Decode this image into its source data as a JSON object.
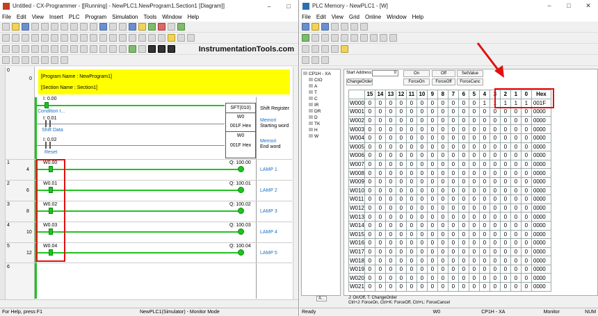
{
  "left_window": {
    "title": "Untitled - CX-Programmer - [[Running] - NewPLC1.NewProgram1.Section1 [Diagram]]",
    "menu": [
      "File",
      "Edit",
      "View",
      "Insert",
      "PLC",
      "Program",
      "Simulation",
      "Tools",
      "Window",
      "Help"
    ],
    "brand": "InstrumentationTools.com",
    "program_name": "[Program Name : NewProgram1]",
    "section_name": "[Section Name : Section1]",
    "rung0": {
      "num": "0",
      "step": "0",
      "c1_addr": "I: 0.00",
      "c1_label": "Condition I...",
      "c2_addr": "I: 0.01",
      "c2_label": "Shift Data",
      "c3_addr": "I: 0.02",
      "c3_label": "Reset",
      "box_title": "SFT(010)",
      "box_op1": "W0",
      "box_op2": "001F Hex",
      "box_op3": "W0",
      "box_op4": "001F Hex",
      "r_label1": "Shift Register",
      "r_mem1": "Memori",
      "r_word1": "Starting word",
      "r_mem2": "Memori",
      "r_word2": "End word"
    },
    "rungs": [
      {
        "num": "1",
        "step": "4",
        "contact": "W0.00",
        "coil": "Q: 100.00",
        "lamp": "LAMP 1"
      },
      {
        "num": "2",
        "step": "6",
        "contact": "W0.01",
        "coil": "Q: 100.01",
        "lamp": "LAMP 2"
      },
      {
        "num": "3",
        "step": "8",
        "contact": "W0.02",
        "coil": "Q: 100.02",
        "lamp": "LAMP 3"
      },
      {
        "num": "4",
        "step": "10",
        "contact": "W0.03",
        "coil": "Q: 100.03",
        "lamp": "LAMP 4"
      },
      {
        "num": "5",
        "step": "12",
        "contact": "W0.04",
        "coil": "Q: 100.04",
        "lamp": "LAMP 5"
      }
    ],
    "rung_last": "6",
    "status_left": "For Help, press F1",
    "status_mid": "NewPLC1(Simulator) - Monitor Mode"
  },
  "right_window": {
    "title": "PLC Memory - NewPLC1 - [W]",
    "menu": [
      "File",
      "Edit",
      "View",
      "Grid",
      "Online",
      "Window",
      "Help"
    ],
    "tree": [
      "CP1H - XA",
      "CIO",
      "A",
      "T",
      "C",
      "IR",
      "DR",
      "D",
      "TK",
      "H",
      "W"
    ],
    "tree_tab": "A...",
    "start_address_label": "Start Address:",
    "start_address_value": "0",
    "buttons": [
      "On",
      "Off",
      "SetValue",
      "ChangeOrder",
      "ForceOn",
      "ForceOff",
      "ForceCanc"
    ],
    "columns": [
      "",
      "15",
      "14",
      "13",
      "12",
      "11",
      "10",
      "9",
      "8",
      "7",
      "6",
      "5",
      "4",
      "3",
      "2",
      "1",
      "0",
      "Hex"
    ],
    "rows": [
      [
        "W000",
        "0",
        "0",
        "0",
        "0",
        "0",
        "0",
        "0",
        "0",
        "0",
        "0",
        "0",
        "1",
        "1",
        "1",
        "1",
        "1",
        "001F"
      ],
      [
        "W001",
        "0",
        "0",
        "0",
        "0",
        "0",
        "0",
        "0",
        "0",
        "0",
        "0",
        "0",
        "0",
        "0",
        "0",
        "0",
        "0",
        "0000"
      ],
      [
        "W002",
        "0",
        "0",
        "0",
        "0",
        "0",
        "0",
        "0",
        "0",
        "0",
        "0",
        "0",
        "0",
        "0",
        "0",
        "0",
        "0",
        "0000"
      ],
      [
        "W003",
        "0",
        "0",
        "0",
        "0",
        "0",
        "0",
        "0",
        "0",
        "0",
        "0",
        "0",
        "0",
        "0",
        "0",
        "0",
        "0",
        "0000"
      ],
      [
        "W004",
        "0",
        "0",
        "0",
        "0",
        "0",
        "0",
        "0",
        "0",
        "0",
        "0",
        "0",
        "0",
        "0",
        "0",
        "0",
        "0",
        "0000"
      ],
      [
        "W005",
        "0",
        "0",
        "0",
        "0",
        "0",
        "0",
        "0",
        "0",
        "0",
        "0",
        "0",
        "0",
        "0",
        "0",
        "0",
        "0",
        "0000"
      ],
      [
        "W006",
        "0",
        "0",
        "0",
        "0",
        "0",
        "0",
        "0",
        "0",
        "0",
        "0",
        "0",
        "0",
        "0",
        "0",
        "0",
        "0",
        "0000"
      ],
      [
        "W007",
        "0",
        "0",
        "0",
        "0",
        "0",
        "0",
        "0",
        "0",
        "0",
        "0",
        "0",
        "0",
        "0",
        "0",
        "0",
        "0",
        "0000"
      ],
      [
        "W008",
        "0",
        "0",
        "0",
        "0",
        "0",
        "0",
        "0",
        "0",
        "0",
        "0",
        "0",
        "0",
        "0",
        "0",
        "0",
        "0",
        "0000"
      ],
      [
        "W009",
        "0",
        "0",
        "0",
        "0",
        "0",
        "0",
        "0",
        "0",
        "0",
        "0",
        "0",
        "0",
        "0",
        "0",
        "0",
        "0",
        "0000"
      ],
      [
        "W010",
        "0",
        "0",
        "0",
        "0",
        "0",
        "0",
        "0",
        "0",
        "0",
        "0",
        "0",
        "0",
        "0",
        "0",
        "0",
        "0",
        "0000"
      ],
      [
        "W011",
        "0",
        "0",
        "0",
        "0",
        "0",
        "0",
        "0",
        "0",
        "0",
        "0",
        "0",
        "0",
        "0",
        "0",
        "0",
        "0",
        "0000"
      ],
      [
        "W012",
        "0",
        "0",
        "0",
        "0",
        "0",
        "0",
        "0",
        "0",
        "0",
        "0",
        "0",
        "0",
        "0",
        "0",
        "0",
        "0",
        "0000"
      ],
      [
        "W013",
        "0",
        "0",
        "0",
        "0",
        "0",
        "0",
        "0",
        "0",
        "0",
        "0",
        "0",
        "0",
        "0",
        "0",
        "0",
        "0",
        "0000"
      ],
      [
        "W014",
        "0",
        "0",
        "0",
        "0",
        "0",
        "0",
        "0",
        "0",
        "0",
        "0",
        "0",
        "0",
        "0",
        "0",
        "0",
        "0",
        "0000"
      ],
      [
        "W015",
        "0",
        "0",
        "0",
        "0",
        "0",
        "0",
        "0",
        "0",
        "0",
        "0",
        "0",
        "0",
        "0",
        "0",
        "0",
        "0",
        "0000"
      ],
      [
        "W016",
        "0",
        "0",
        "0",
        "0",
        "0",
        "0",
        "0",
        "0",
        "0",
        "0",
        "0",
        "0",
        "0",
        "0",
        "0",
        "0",
        "0000"
      ],
      [
        "W017",
        "0",
        "0",
        "0",
        "0",
        "0",
        "0",
        "0",
        "0",
        "0",
        "0",
        "0",
        "0",
        "0",
        "0",
        "0",
        "0",
        "0000"
      ],
      [
        "W018",
        "0",
        "0",
        "0",
        "0",
        "0",
        "0",
        "0",
        "0",
        "0",
        "0",
        "0",
        "0",
        "0",
        "0",
        "0",
        "0",
        "0000"
      ],
      [
        "W019",
        "0",
        "0",
        "0",
        "0",
        "0",
        "0",
        "0",
        "0",
        "0",
        "0",
        "0",
        "0",
        "0",
        "0",
        "0",
        "0",
        "0000"
      ],
      [
        "W020",
        "0",
        "0",
        "0",
        "0",
        "0",
        "0",
        "0",
        "0",
        "0",
        "0",
        "0",
        "0",
        "0",
        "0",
        "0",
        "0",
        "0000"
      ],
      [
        "W021",
        "0",
        "0",
        "0",
        "0",
        "0",
        "0",
        "0",
        "0",
        "0",
        "0",
        "0",
        "0",
        "0",
        "0",
        "0",
        "0",
        "0000"
      ]
    ],
    "legend1": "J:  On/Off,   T:  ChangeOrder",
    "legend2": "Ctrl+J: ForceOn,  Ctrl+K: ForceOff,  Ctrl+L: ForceCancel",
    "status": [
      "Ready",
      "W0",
      "CP1H - XA",
      "Monitor",
      "NUM"
    ]
  },
  "colors": {
    "energized": "#1ec31e",
    "highlight": "#ffff00",
    "callout": "#e01010",
    "link": "#1a6fc0"
  }
}
